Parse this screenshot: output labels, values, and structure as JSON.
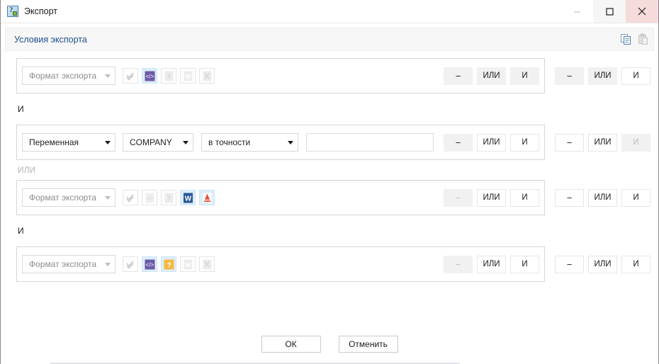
{
  "window": {
    "title": "Экспорт",
    "app_icon": "export-question-icon",
    "controls": {
      "minimize": "−",
      "maximize": "□",
      "close": "✕"
    }
  },
  "panel": {
    "title": "Условия экспорта",
    "tools": [
      {
        "name": "copy-icon",
        "label": "Копировать"
      },
      {
        "name": "paste-icon",
        "label": "Вставить"
      }
    ]
  },
  "format_icons": [
    {
      "name": "check-all-icon",
      "glyph": "checks"
    },
    {
      "name": "xml-format-icon",
      "glyph": "xml"
    },
    {
      "name": "pdf-format-icon",
      "glyph": "pdf"
    },
    {
      "name": "word-format-icon",
      "glyph": "word"
    },
    {
      "name": "excel-format-icon",
      "glyph": "excel"
    }
  ],
  "operators": {
    "minus": "−",
    "or": "ИЛИ",
    "and": "И"
  },
  "connectors": [
    {
      "label": "И",
      "active": true
    },
    {
      "label": "ИЛИ",
      "active": false
    },
    {
      "label": "И",
      "active": true
    }
  ],
  "rows": [
    {
      "type": "format",
      "field": "Формат экспорта",
      "field_muted": true,
      "icons": [
        {
          "name": "check-all-icon",
          "state": "off"
        },
        {
          "name": "xml-format-icon",
          "state": "on"
        },
        {
          "name": "pdf-format-icon",
          "state": "off"
        },
        {
          "name": "word-format-icon",
          "state": "off"
        },
        {
          "name": "excel-format-icon",
          "state": "off"
        }
      ],
      "inner": {
        "minus": "fill",
        "or": "fill",
        "and": "fill"
      },
      "outer": {
        "minus": "fill",
        "or": "fill",
        "and": "out"
      }
    },
    {
      "type": "variable",
      "field": "Переменная",
      "field_muted": false,
      "variable": "COMPANY",
      "comparison": "в точности",
      "value": "",
      "value_placeholder": "",
      "inner": {
        "minus": "fill",
        "or": "out",
        "and": "out"
      },
      "outer": {
        "minus": "out",
        "or": "out",
        "and": "dim"
      }
    },
    {
      "type": "format",
      "field": "Формат экспорта",
      "field_muted": true,
      "icons": [
        {
          "name": "check-all-icon",
          "state": "off"
        },
        {
          "name": "xml-format-icon",
          "state": "off"
        },
        {
          "name": "pdf-format-icon",
          "state": "off"
        },
        {
          "name": "word-format-icon",
          "state": "on"
        },
        {
          "name": "excel-pdf-icon",
          "state": "on"
        }
      ],
      "inner": {
        "minus": "dim",
        "or": "out",
        "and": "out"
      },
      "outer": {
        "minus": "out",
        "or": "out",
        "and": "out"
      }
    },
    {
      "type": "format",
      "field": "Формат экспорта",
      "field_muted": true,
      "icons": [
        {
          "name": "check-all-icon",
          "state": "off"
        },
        {
          "name": "xml-format-icon",
          "state": "on"
        },
        {
          "name": "pdf-format-icon",
          "state": "on"
        },
        {
          "name": "word-format-icon",
          "state": "off"
        },
        {
          "name": "excel-format-icon",
          "state": "off"
        }
      ],
      "inner": {
        "minus": "dim",
        "or": "out",
        "and": "out"
      },
      "outer": {
        "minus": "out",
        "or": "out",
        "and": "out"
      }
    }
  ],
  "footer": {
    "ok": "ОК",
    "cancel": "Отменить"
  },
  "colors": {
    "accent_link": "#20508c",
    "xml_purple": "#6e5aa8",
    "word_blue": "#2b5797",
    "pdf_red": "#d93a2b",
    "help_orange": "#f5a623",
    "selection_blue": "#ddeefb",
    "close_hover": "#f6dbdb"
  }
}
